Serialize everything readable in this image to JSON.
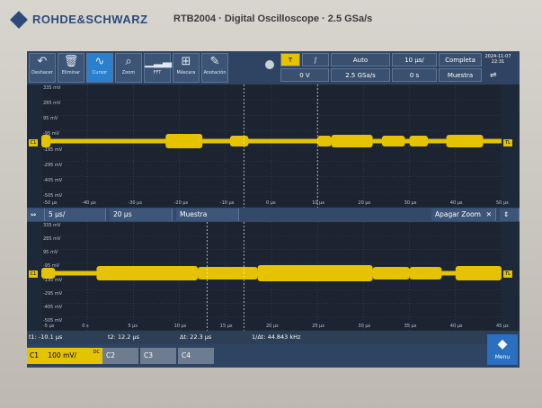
{
  "header": {
    "brand": "ROHDE&SCHWARZ",
    "model": "RTB2004 · Digital Oscilloscope · 2.5 GSa/s"
  },
  "toolbar": {
    "buttons": [
      {
        "label": "Deshacer",
        "icon": "undo-icon"
      },
      {
        "label": "Eliminar",
        "icon": "trash-icon"
      },
      {
        "label": "Cursor",
        "icon": "wave-icon"
      },
      {
        "label": "Zoom",
        "icon": "zoom-icon"
      },
      {
        "label": "FFT",
        "icon": "fft-icon"
      },
      {
        "label": "Máscara",
        "icon": "mask-icon"
      },
      {
        "label": "Anotación",
        "icon": "pencil-icon"
      }
    ],
    "trigger": {
      "mode": "Auto",
      "level": "0 V",
      "sample_rate": "2.5 GSa/s",
      "timebase": "10 µs/",
      "position": "0 s",
      "acquire": "Completa",
      "acquire_mode": "Muestra"
    },
    "date": "2024-11-07",
    "time": "22:31"
  },
  "top_grid": {
    "y_labels": [
      "335 mV",
      "285 mV",
      "95 mV",
      "-95 mV",
      "-195 mV",
      "-295 mV",
      "-405 mV",
      "-505 mV"
    ],
    "x_labels": [
      "-50 µs",
      "-40 µs",
      "-30 µs",
      "-20 µs",
      "-10 µs",
      "0 µs",
      "10 µs",
      "20 µs",
      "30 µs",
      "40 µs",
      "50 µs"
    ]
  },
  "zoom_bar": {
    "scale": "5 µs/",
    "position": "20 µs",
    "mode": "Muestra",
    "close_label": "Apagar Zoom"
  },
  "bottom_grid": {
    "y_labels": [
      "335 mV",
      "285 mV",
      "95 mV",
      "-95 mV",
      "-195 mV",
      "-295 mV",
      "-405 mV",
      "-505 mV"
    ],
    "x_labels": [
      "-5 µs",
      "0 s",
      "5 µs",
      "10 µs",
      "15 µs",
      "20 µs",
      "25 µs",
      "30 µs",
      "35 µs",
      "40 µs",
      "45 µs"
    ]
  },
  "cursor_readout": {
    "t1": "t1: -10.1 µs",
    "t2": "t2: 12.2 µs",
    "dt": "Δt: 22.3 µs",
    "freq": "1/Δt: 44.843 kHz"
  },
  "channels": {
    "c1_label": "C1",
    "c1_scale": "100 mV/",
    "c1_coupling": "DC",
    "c2_label": "C2",
    "c3_label": "C3",
    "c4_label": "C4"
  },
  "menu_label": "Menu",
  "colors": {
    "trace": "#e5c300",
    "accent": "#2b7fcf"
  }
}
